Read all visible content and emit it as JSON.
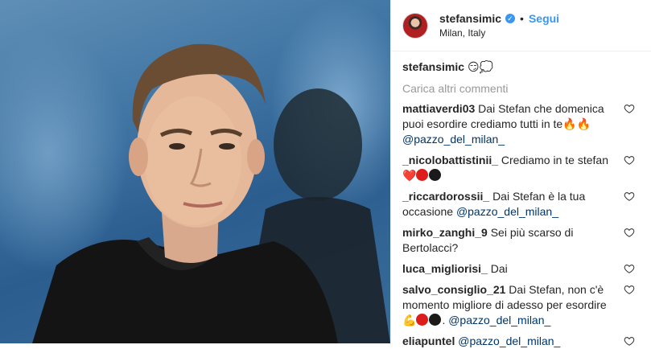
{
  "header": {
    "username": "stefansimic",
    "follow_label": "Segui",
    "location": "Milan, Italy",
    "separator": "•"
  },
  "caption": {
    "username": "stefansimic",
    "text": "😏💭"
  },
  "load_more": "Carica altri commenti",
  "comments": [
    {
      "user": "mattiaverdi03",
      "text": "Dai Stefan che domenica puoi esordire crediamo tutti in te",
      "mention": "@pazzo_del_milan_"
    },
    {
      "user": "_nicolobattistinii_",
      "text": "Crediamo in te stefan"
    },
    {
      "user": "_riccardorossii_",
      "text": "Dai Stefan è la tua occasione",
      "mention": "@pazzo_del_milan_"
    },
    {
      "user": "mirko_zanghi_9",
      "text": "Sei più scarso di Bertolacci?"
    },
    {
      "user": "luca_migliorisi_",
      "text": "Dai"
    },
    {
      "user": "salvo_consiglio_21",
      "text": "Dai Stefan, non c'è momento migliore di adesso per esordire",
      "suffix": ".",
      "mention": "@pazzo_del_milan_"
    },
    {
      "user": "eliapuntel",
      "text": "",
      "mention": "@pazzo_del_milan_"
    }
  ],
  "icons": {
    "verified": "verified-badge-icon",
    "heart": "heart-outline-icon",
    "emoji_fire": "🔥",
    "emoji_heart": "❤️",
    "emoji_muscle": "💪"
  },
  "colors": {
    "link": "#3897f0",
    "mention": "#003569",
    "muted": "#999999",
    "text": "#262626"
  }
}
